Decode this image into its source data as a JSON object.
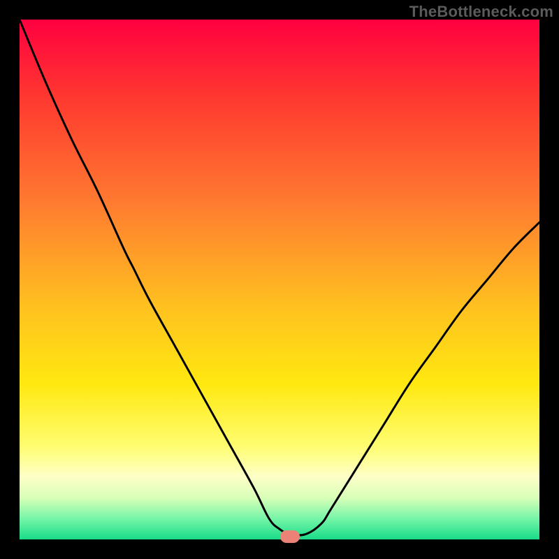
{
  "watermark": "TheBottleneck.com",
  "chart_data": {
    "type": "line",
    "title": "",
    "xlabel": "",
    "ylabel": "",
    "xlim": [
      0,
      100
    ],
    "ylim": [
      0,
      100
    ],
    "grid": false,
    "legend": false,
    "series": [
      {
        "name": "bottleneck-curve",
        "x": [
          0,
          5,
          10,
          15,
          20,
          22,
          25,
          30,
          35,
          40,
          45,
          48,
          50,
          52,
          55,
          58,
          60,
          65,
          70,
          75,
          80,
          85,
          90,
          95,
          100
        ],
        "y": [
          100,
          88,
          77,
          67,
          56,
          52,
          46,
          37,
          28,
          19,
          10,
          4,
          2,
          1,
          1,
          3,
          6,
          14,
          22,
          30,
          37,
          44,
          50,
          56,
          61
        ]
      }
    ],
    "marker": {
      "x": 52,
      "y": 0.6
    },
    "background_gradient": {
      "direction": "top-to-bottom",
      "stops": [
        {
          "pos": 0.0,
          "color": "#ff0040"
        },
        {
          "pos": 0.15,
          "color": "#ff3830"
        },
        {
          "pos": 0.35,
          "color": "#ff7a30"
        },
        {
          "pos": 0.55,
          "color": "#ffc020"
        },
        {
          "pos": 0.7,
          "color": "#ffe810"
        },
        {
          "pos": 0.82,
          "color": "#fffd70"
        },
        {
          "pos": 0.88,
          "color": "#fdffc8"
        },
        {
          "pos": 0.92,
          "color": "#d8ffb8"
        },
        {
          "pos": 0.96,
          "color": "#76f5a8"
        },
        {
          "pos": 1.0,
          "color": "#18dC88"
        }
      ]
    }
  }
}
